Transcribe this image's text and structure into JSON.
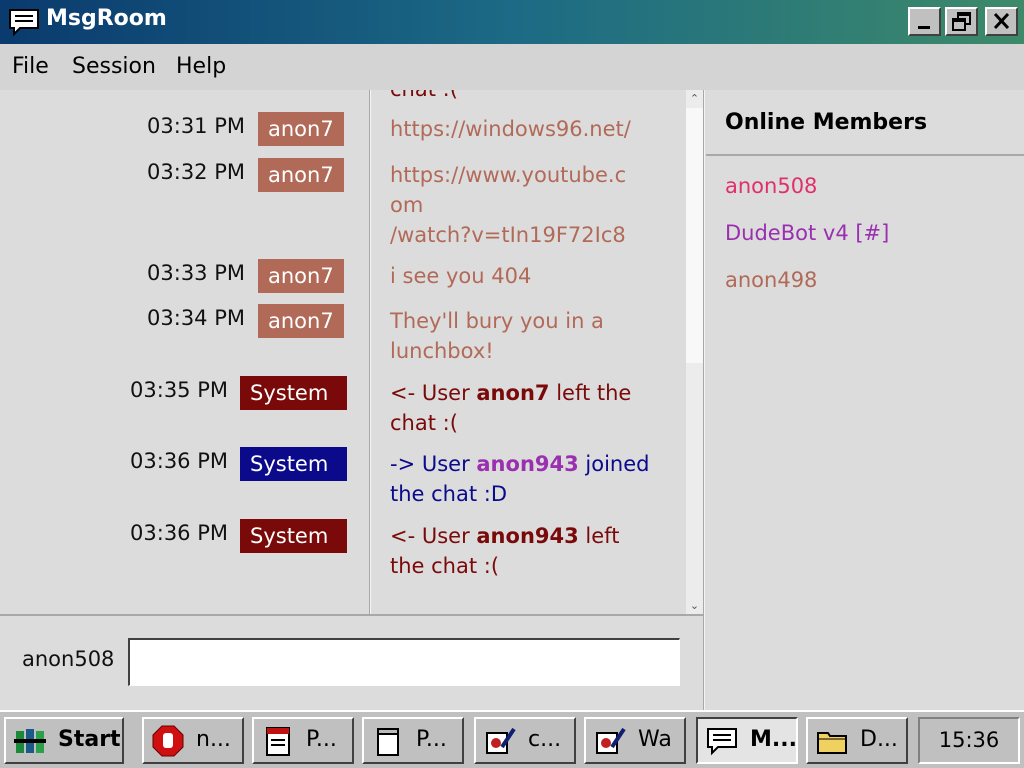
{
  "window": {
    "title": "MsgRoom"
  },
  "menu": {
    "file": "File",
    "session": "Session",
    "help": "Help"
  },
  "chat": {
    "top_partial": "chat :(",
    "messages": [
      {
        "time": "03:31 PM",
        "user": "anon7",
        "badge_color": "#b26a58",
        "lines": [
          "https://windows96.net/"
        ],
        "text_color": "#b26a58"
      },
      {
        "time": "03:32 PM",
        "user": "anon7",
        "badge_color": "#b26a58",
        "lines": [
          "https://www.youtube.c",
          "om",
          "/watch?v=tIn19F72Ic8"
        ],
        "text_color": "#b26a58"
      },
      {
        "time": "03:33 PM",
        "user": "anon7",
        "badge_color": "#b26a58",
        "lines": [
          "i see you 404"
        ],
        "text_color": "#b26a58"
      },
      {
        "time": "03:34 PM",
        "user": "anon7",
        "badge_color": "#b26a58",
        "lines": [
          "They'll bury you in a",
          "lunchbox!"
        ],
        "text_color": "#b26a58"
      },
      {
        "time": "03:35 PM",
        "user": "System",
        "badge_color": "#7a0a0a",
        "prefix": "<- User ",
        "name": "anon7",
        "suffix": " left the",
        "line2": "chat :(",
        "text_color": "#7a0a0a",
        "name_color": "#7a0a0a"
      },
      {
        "time": "03:36 PM",
        "user": "System",
        "badge_color": "#0a0a8a",
        "prefix": "-> User ",
        "name": "anon943",
        "suffix": " joined",
        "line2": "the chat :D",
        "text_color": "#0a0a8a",
        "name_color": "#9a30b0"
      },
      {
        "time": "03:36 PM",
        "user": "System",
        "badge_color": "#7a0a0a",
        "prefix": "<- User ",
        "name": "anon943",
        "suffix": " left",
        "line2": "the chat :(",
        "text_color": "#7a0a0a",
        "name_color": "#7a0a0a"
      }
    ]
  },
  "input": {
    "username": "anon508",
    "value": ""
  },
  "members": {
    "title": "Online Members",
    "list": [
      {
        "name": "anon508",
        "color": "#e0306a"
      },
      {
        "name": "DudeBot v4 [#]",
        "color": "#9a30b0"
      },
      {
        "name": "anon498",
        "color": "#b26a58"
      }
    ]
  },
  "taskbar": {
    "start": "Start",
    "buttons": [
      {
        "label": "n...",
        "icon": "stop-hand-icon"
      },
      {
        "label": "P...",
        "icon": "document-icon"
      },
      {
        "label": "P...",
        "icon": "notepad-icon"
      },
      {
        "label": "c...",
        "icon": "picture-edit-icon"
      },
      {
        "label": "Wa",
        "icon": "picture-edit-icon"
      },
      {
        "label": "M...",
        "icon": "chat-icon",
        "active": true
      },
      {
        "label": "D...",
        "icon": "folder-icon"
      }
    ],
    "clock": "15:36"
  }
}
